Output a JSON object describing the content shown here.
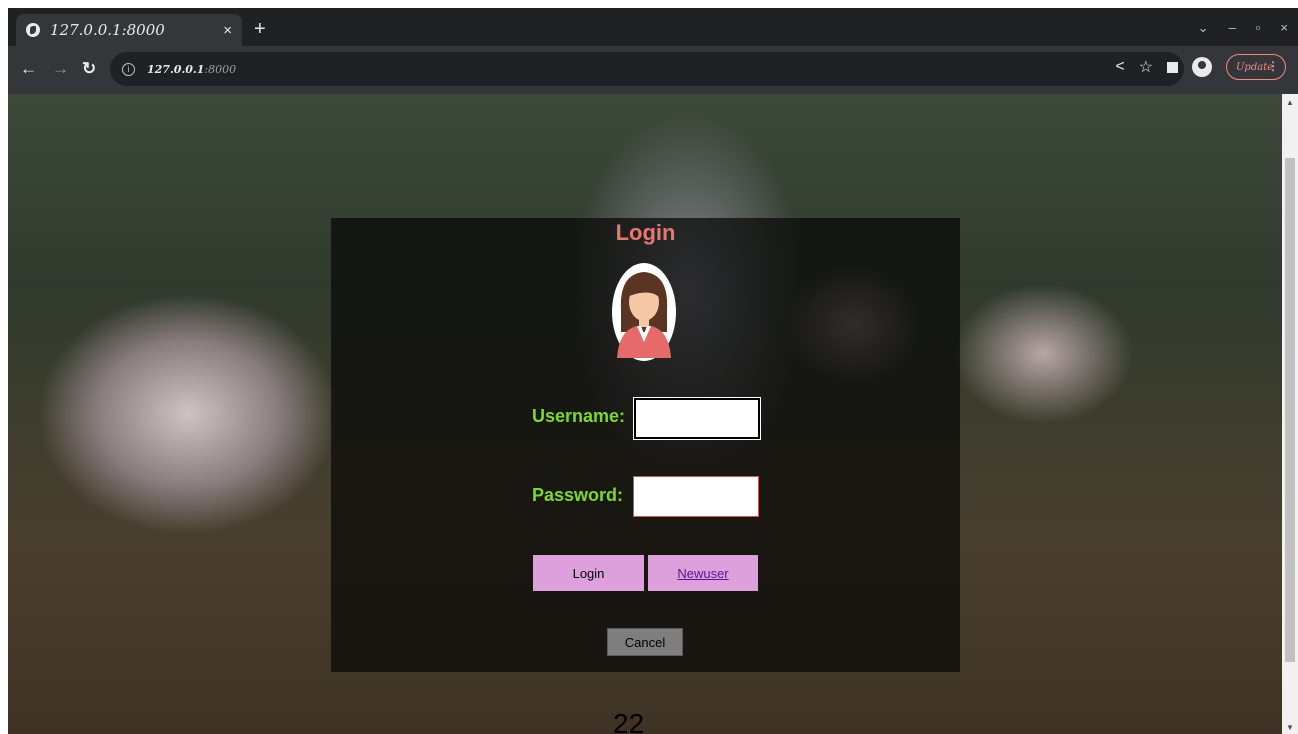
{
  "browser": {
    "tab_title": "127.0.0.1:8000",
    "tab_close": "×",
    "new_tab": "+",
    "url_host": "127.0.0.1",
    "url_port": ":8000",
    "update_label": "Update",
    "window_controls": [
      "⌄",
      "–",
      "▫",
      "×"
    ]
  },
  "page": {
    "title": "Login",
    "username_label": "Username:",
    "password_label": "Password:",
    "username_value": "",
    "password_value": "",
    "login_button": "Login",
    "newuser_link": "Newuser",
    "cancel_button": "Cancel",
    "page_number": "22"
  },
  "colors": {
    "title": "#e9766e",
    "labels": "#7bd92c",
    "buttons": "#dda0dd"
  },
  "icons": {
    "avatar": "female-avatar-icon",
    "back": "back-arrow-icon",
    "forward": "forward-arrow-icon",
    "reload": "reload-icon",
    "share": "share-icon",
    "bookmark": "star-icon",
    "sidepanel": "side-panel-icon",
    "profile": "profile-icon",
    "menu": "kebab-menu-icon"
  }
}
